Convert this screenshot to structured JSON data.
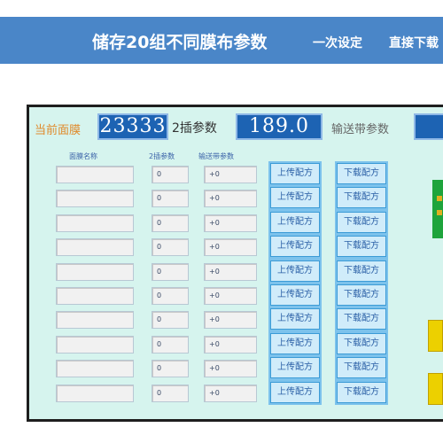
{
  "banner": {
    "title": "储存20组不同膜布参数",
    "subtitle1": "一次设定",
    "subtitle2": "直接下载"
  },
  "hmi": {
    "current_label": "当前面膜",
    "current_value": "23333",
    "param2_label": "2插参数",
    "param2_value": "189.0",
    "conveyor_label": "输送带参数",
    "columns": {
      "name": "面膜名称",
      "param2": "2插参数",
      "conveyor": "输送带参数"
    },
    "rows": [
      {
        "name": "",
        "param2": "0",
        "conveyor": "+0",
        "upload": "上传配方",
        "download": "下载配方"
      },
      {
        "name": "",
        "param2": "0",
        "conveyor": "+0",
        "upload": "上传配方",
        "download": "下载配方"
      },
      {
        "name": "",
        "param2": "0",
        "conveyor": "+0",
        "upload": "上传配方",
        "download": "下载配方"
      },
      {
        "name": "",
        "param2": "0",
        "conveyor": "+0",
        "upload": "上传配方",
        "download": "下载配方"
      },
      {
        "name": "",
        "param2": "0",
        "conveyor": "+0",
        "upload": "上传配方",
        "download": "下载配方"
      },
      {
        "name": "",
        "param2": "0",
        "conveyor": "+0",
        "upload": "上传配方",
        "download": "下载配方"
      },
      {
        "name": "",
        "param2": "0",
        "conveyor": "+0",
        "upload": "上传配方",
        "download": "下载配方"
      },
      {
        "name": "",
        "param2": "0",
        "conveyor": "+0",
        "upload": "上传配方",
        "download": "下载配方"
      },
      {
        "name": "",
        "param2": "0",
        "conveyor": "+0",
        "upload": "上传配方",
        "download": "下载配方"
      },
      {
        "name": "",
        "param2": "0",
        "conveyor": "+0",
        "upload": "上传配方",
        "download": "下载配方"
      }
    ]
  },
  "colors": {
    "banner": "#4a86c8",
    "screen": "#d6f4ee",
    "display_box": "#1d63b3",
    "button": "#d0ecfa",
    "side_green": "#1ea43c",
    "side_yellow": "#ecd000"
  }
}
